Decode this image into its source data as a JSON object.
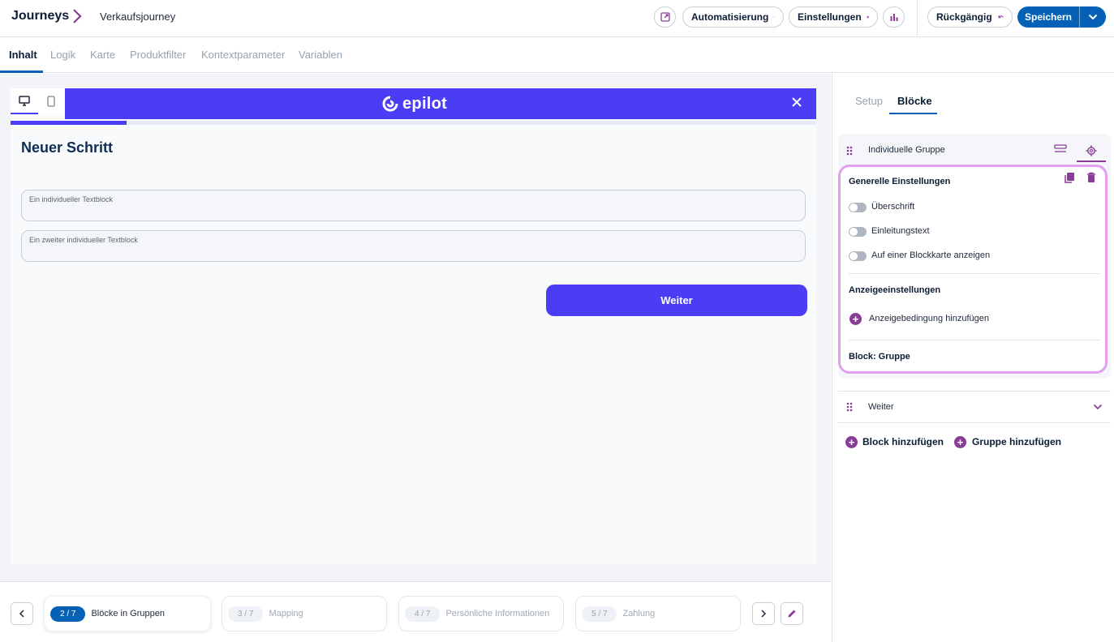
{
  "header": {
    "brand": "Journeys",
    "journey_name": "Verkaufsjourney",
    "automation_label": "Automatisierung",
    "settings_label": "Einstellungen",
    "undo_label": "Rückgängig",
    "save_label": "Speichern"
  },
  "tabs": [
    "Inhalt",
    "Logik",
    "Karte",
    "Produktfilter",
    "Kontextparameter",
    "Variablen"
  ],
  "preview": {
    "logo_text": "epilot",
    "progress": 0.144,
    "step_title": "Neuer Schritt",
    "textblocks": [
      "Ein individueller Textblock",
      "Ein zweiter individueller Textblock"
    ],
    "next_button": "Weiter"
  },
  "steps": [
    {
      "badge": "2 / 7",
      "label": "Blöcke in Gruppen",
      "active": true
    },
    {
      "badge": "3 / 7",
      "label": "Mapping",
      "active": false
    },
    {
      "badge": "4 / 7",
      "label": "Persönliche Informationen",
      "active": false
    },
    {
      "badge": "5 / 7",
      "label": "Zahlung",
      "active": false
    }
  ],
  "panel": {
    "tabs": [
      "Setup",
      "Blöcke"
    ],
    "group_title": "Individuelle Gruppe",
    "general_title": "Generelle Einstellungen",
    "toggles": [
      "Überschrift",
      "Einleitungstext",
      "Auf einer Blockkarte anzeigen"
    ],
    "display_title": "Anzeigeeinstellungen",
    "add_condition": "Anzeigebedingung hinzufügen",
    "block_label": "Block: Gruppe",
    "weiter_row": "Weiter",
    "add_block": "Block hinzufügen",
    "add_group": "Gruppe hinzufügen"
  },
  "colors": {
    "primary": "#0561b5",
    "brand": "#4b3df4",
    "accent": "#8a3d96",
    "highlight": "#e49ef0"
  }
}
